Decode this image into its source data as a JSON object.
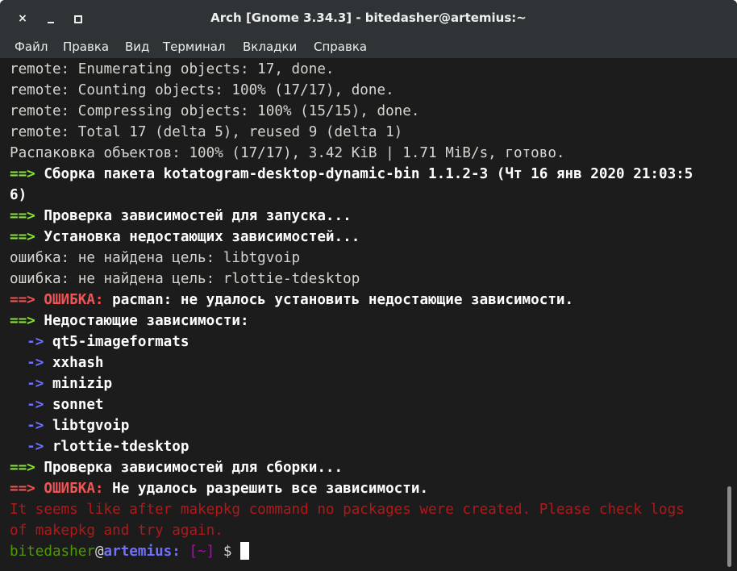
{
  "window": {
    "title": "Arch [Gnome 3.34.3] - bitedasher@artemius:~",
    "close_glyph": "×",
    "colors": {
      "background": "#1c1c1c",
      "titlebar": "#2e3436",
      "prompt_user": "#4e9a06",
      "prompt_host": "#7070ff",
      "prompt_path": "#c000c0",
      "arrow_green": "#8ae234",
      "error_red": "#ef5555",
      "dark_red": "#b21818"
    }
  },
  "menu": {
    "file": "Файл",
    "edit": "Правка",
    "view": "Вид",
    "terminal": "Терминал",
    "tabs": "Вкладки",
    "help": "Справка"
  },
  "terminal": {
    "lines": [
      {
        "text": "remote: Enumerating objects: 17, done."
      },
      {
        "text": "remote: Counting objects: 100% (17/17), done."
      },
      {
        "text": "remote: Compressing objects: 100% (15/15), done."
      },
      {
        "text": "remote: Total 17 (delta 5), reused 9 (delta 1)"
      },
      {
        "text": "Распаковка объектов: 100% (17/17), 3.42 KiB | 1.71 MiB/s, готово."
      },
      {
        "arrow": "==>",
        "text": " Сборка пакета kotatogram-desktop-dynamic-bin 1.1.2-3 (Чт 16 янв 2020 21:03:5"
      },
      {
        "text": "6)"
      },
      {
        "arrow": "==>",
        "text": " Проверка зависимостей для запуска..."
      },
      {
        "arrow": "==>",
        "text": " Установка недостающих зависимостей..."
      },
      {
        "text": "ошибка: не найдена цель: libtgvoip"
      },
      {
        "text": "ошибка: не найдена цель: rlottie-tdesktop"
      },
      {
        "arrow": "==>",
        "label": " ОШИБКА:",
        "text": " pacman: не удалось установить недостающие зависимости."
      },
      {
        "arrow": "==>",
        "text": " Недостающие зависимости:"
      },
      {
        "sub_arrow": "  ->",
        "text": " qt5-imageformats"
      },
      {
        "sub_arrow": "  ->",
        "text": " xxhash"
      },
      {
        "sub_arrow": "  ->",
        "text": " minizip"
      },
      {
        "sub_arrow": "  ->",
        "text": " sonnet"
      },
      {
        "sub_arrow": "  ->",
        "text": " libtgvoip"
      },
      {
        "sub_arrow": "  ->",
        "text": " rlottie-tdesktop"
      },
      {
        "arrow": "==>",
        "text": " Проверка зависимостей для сборки..."
      },
      {
        "arrow": "==>",
        "label": " ОШИБКА:",
        "text": " Не удалось разрешить все зависимости."
      },
      {
        "text": "It seems like after makepkg command no packages were created. Please check logs"
      },
      {
        "text": "of makepkg and try again."
      }
    ],
    "prompt": {
      "user": "bitedasher",
      "at": "@",
      "host": "artemius:",
      "path": " [~]",
      "symbol": " $"
    }
  }
}
